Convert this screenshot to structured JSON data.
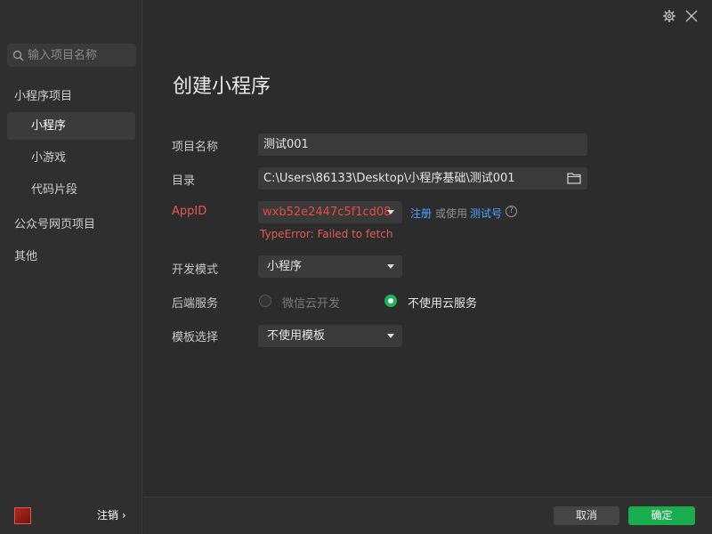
{
  "sidebar": {
    "search_placeholder": "输入项目名称",
    "group_miniprogram": "小程序项目",
    "sub_miniprogram": "小程序",
    "sub_minigame": "小游戏",
    "sub_snippet": "代码片段",
    "group_official": "公众号网页项目",
    "group_other": "其他",
    "logout_label": "注销 ›"
  },
  "page": {
    "title": "创建小程序"
  },
  "form": {
    "project_name_label": "项目名称",
    "project_name_value": "测试001",
    "directory_label": "目录",
    "directory_value": "C:\\Users\\86133\\Desktop\\小程序基础\\测试001",
    "appid_label": "AppID",
    "appid_value": "wxb52e2447c5f1cd08",
    "register_link": "注册",
    "or_use_text": "或使用",
    "test_id_link": "测试号",
    "help_glyph": "?",
    "appid_error": "TypeError: Failed to fetch",
    "dev_mode_label": "开发模式",
    "dev_mode_value": "小程序",
    "backend_label": "后端服务",
    "backend_option_cloud": "微信云开发",
    "backend_option_none": "不使用云服务",
    "backend_selected": "不使用云服务",
    "template_label": "模板选择",
    "template_value": "不使用模板"
  },
  "footer": {
    "cancel_label": "取消",
    "confirm_label": "确定"
  },
  "colors": {
    "accent_green": "#1aad4d",
    "link_blue": "#4da3ff",
    "error_red": "#e35b51"
  }
}
